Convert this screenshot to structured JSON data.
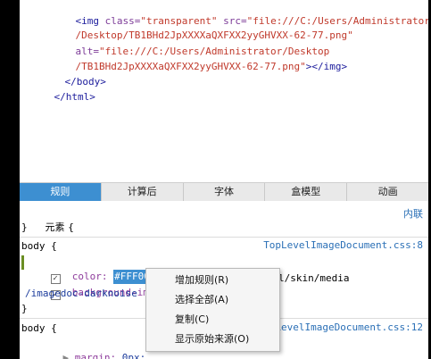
{
  "source": {
    "line1_tag_open": "<img",
    "line1_attr_class": "class=",
    "line1_val_class": "\"transparent\"",
    "line1_attr_src": "src=",
    "line1_val_src": "\"file:///C:/Users/Administrator",
    "line2_val": "/Desktop/TB1BHd2JpXXXXaQXFXX2yyGHVXX-62-77.png\"",
    "line3_attr_alt": "alt=",
    "line3_val": "\"file:///C:/Users/Administrator/Desktop",
    "line4_val": "/TB1BHd2JpXXXXaQXFXX2yyGHVXX-62-77.png\"",
    "line4_tag_close": "></img>",
    "line5": "</body>",
    "line6": "</html>"
  },
  "tabs": [
    {
      "label": "规则",
      "active": true
    },
    {
      "label": "计算后",
      "active": false
    },
    {
      "label": "字体",
      "active": false
    },
    {
      "label": "盒模型",
      "active": false
    },
    {
      "label": "动画",
      "active": false
    }
  ],
  "rules": {
    "element_label": "元素 {",
    "element_close": "}",
    "inline_link": "内联",
    "body1_selector": "body {",
    "body1_source": "TopLevelImageDocument.css:8",
    "color_prop": "color:",
    "color_value": "#FFF000",
    "color_semicolon": ";",
    "bg_prop": "background-imag",
    "bg_value_tail": "l/skin/media",
    "bg_line2": "/imagedoc-darknoise",
    "body1_close": "}",
    "body2_selector": "body {",
    "body2_source": "TopLevelImageDocument.css:12",
    "margin_prop": "margin:",
    "margin_value": "0px;"
  },
  "context_menu": {
    "items": [
      "增加规则(R)",
      "选择全部(A)",
      "复制(C)",
      "显示原始来源(O)"
    ]
  },
  "colors": {
    "active_tab": "#3d8fd1",
    "link": "#2a6fb6"
  }
}
